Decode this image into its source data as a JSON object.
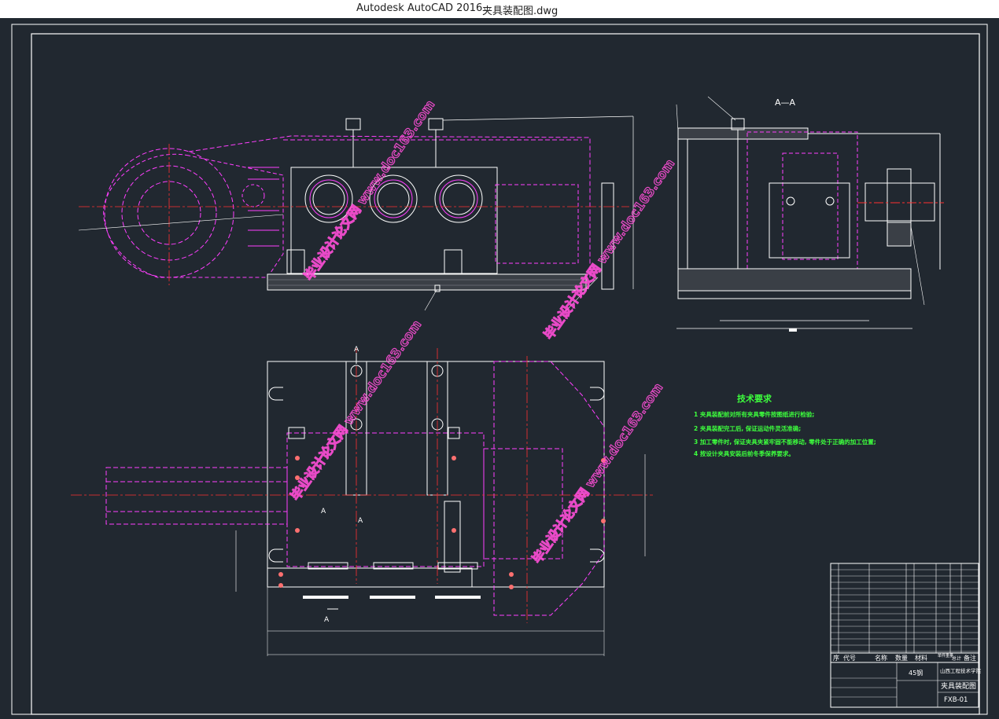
{
  "window": {
    "app_title": "Autodesk AutoCAD 2016",
    "file_name": "夹具装配图.dwg"
  },
  "drawing": {
    "section_label": "A—A",
    "cut_marker": "A",
    "technical_requirements": {
      "title": "技术要求",
      "items": [
        "1 夹具装配前对所有夹具零件按图纸进行检验;",
        "2 夹具装配完工后, 保证运动件灵活准确;",
        "3 加工零件时, 保证夹具夹紧牢固不能移动, 零件处于正确的加工位置;",
        "4 按设计夹具安装后前冬季保养要求。"
      ]
    },
    "watermark": "毕业设计论文网 www.doc163.com",
    "title_block": {
      "material": "45钢",
      "company": "山西工程技术学院",
      "drawing_title": "夹具装配图",
      "drawing_number": "FXB-01",
      "header_cells": [
        "序",
        "代号",
        "名称",
        "数量",
        "材料",
        "单件重量",
        "总计",
        "备注"
      ]
    },
    "colors": {
      "background": "#212830",
      "magenta": "#ff3fff",
      "red": "#ff3030",
      "white": "#ffffff",
      "green": "#3dff3d"
    }
  }
}
